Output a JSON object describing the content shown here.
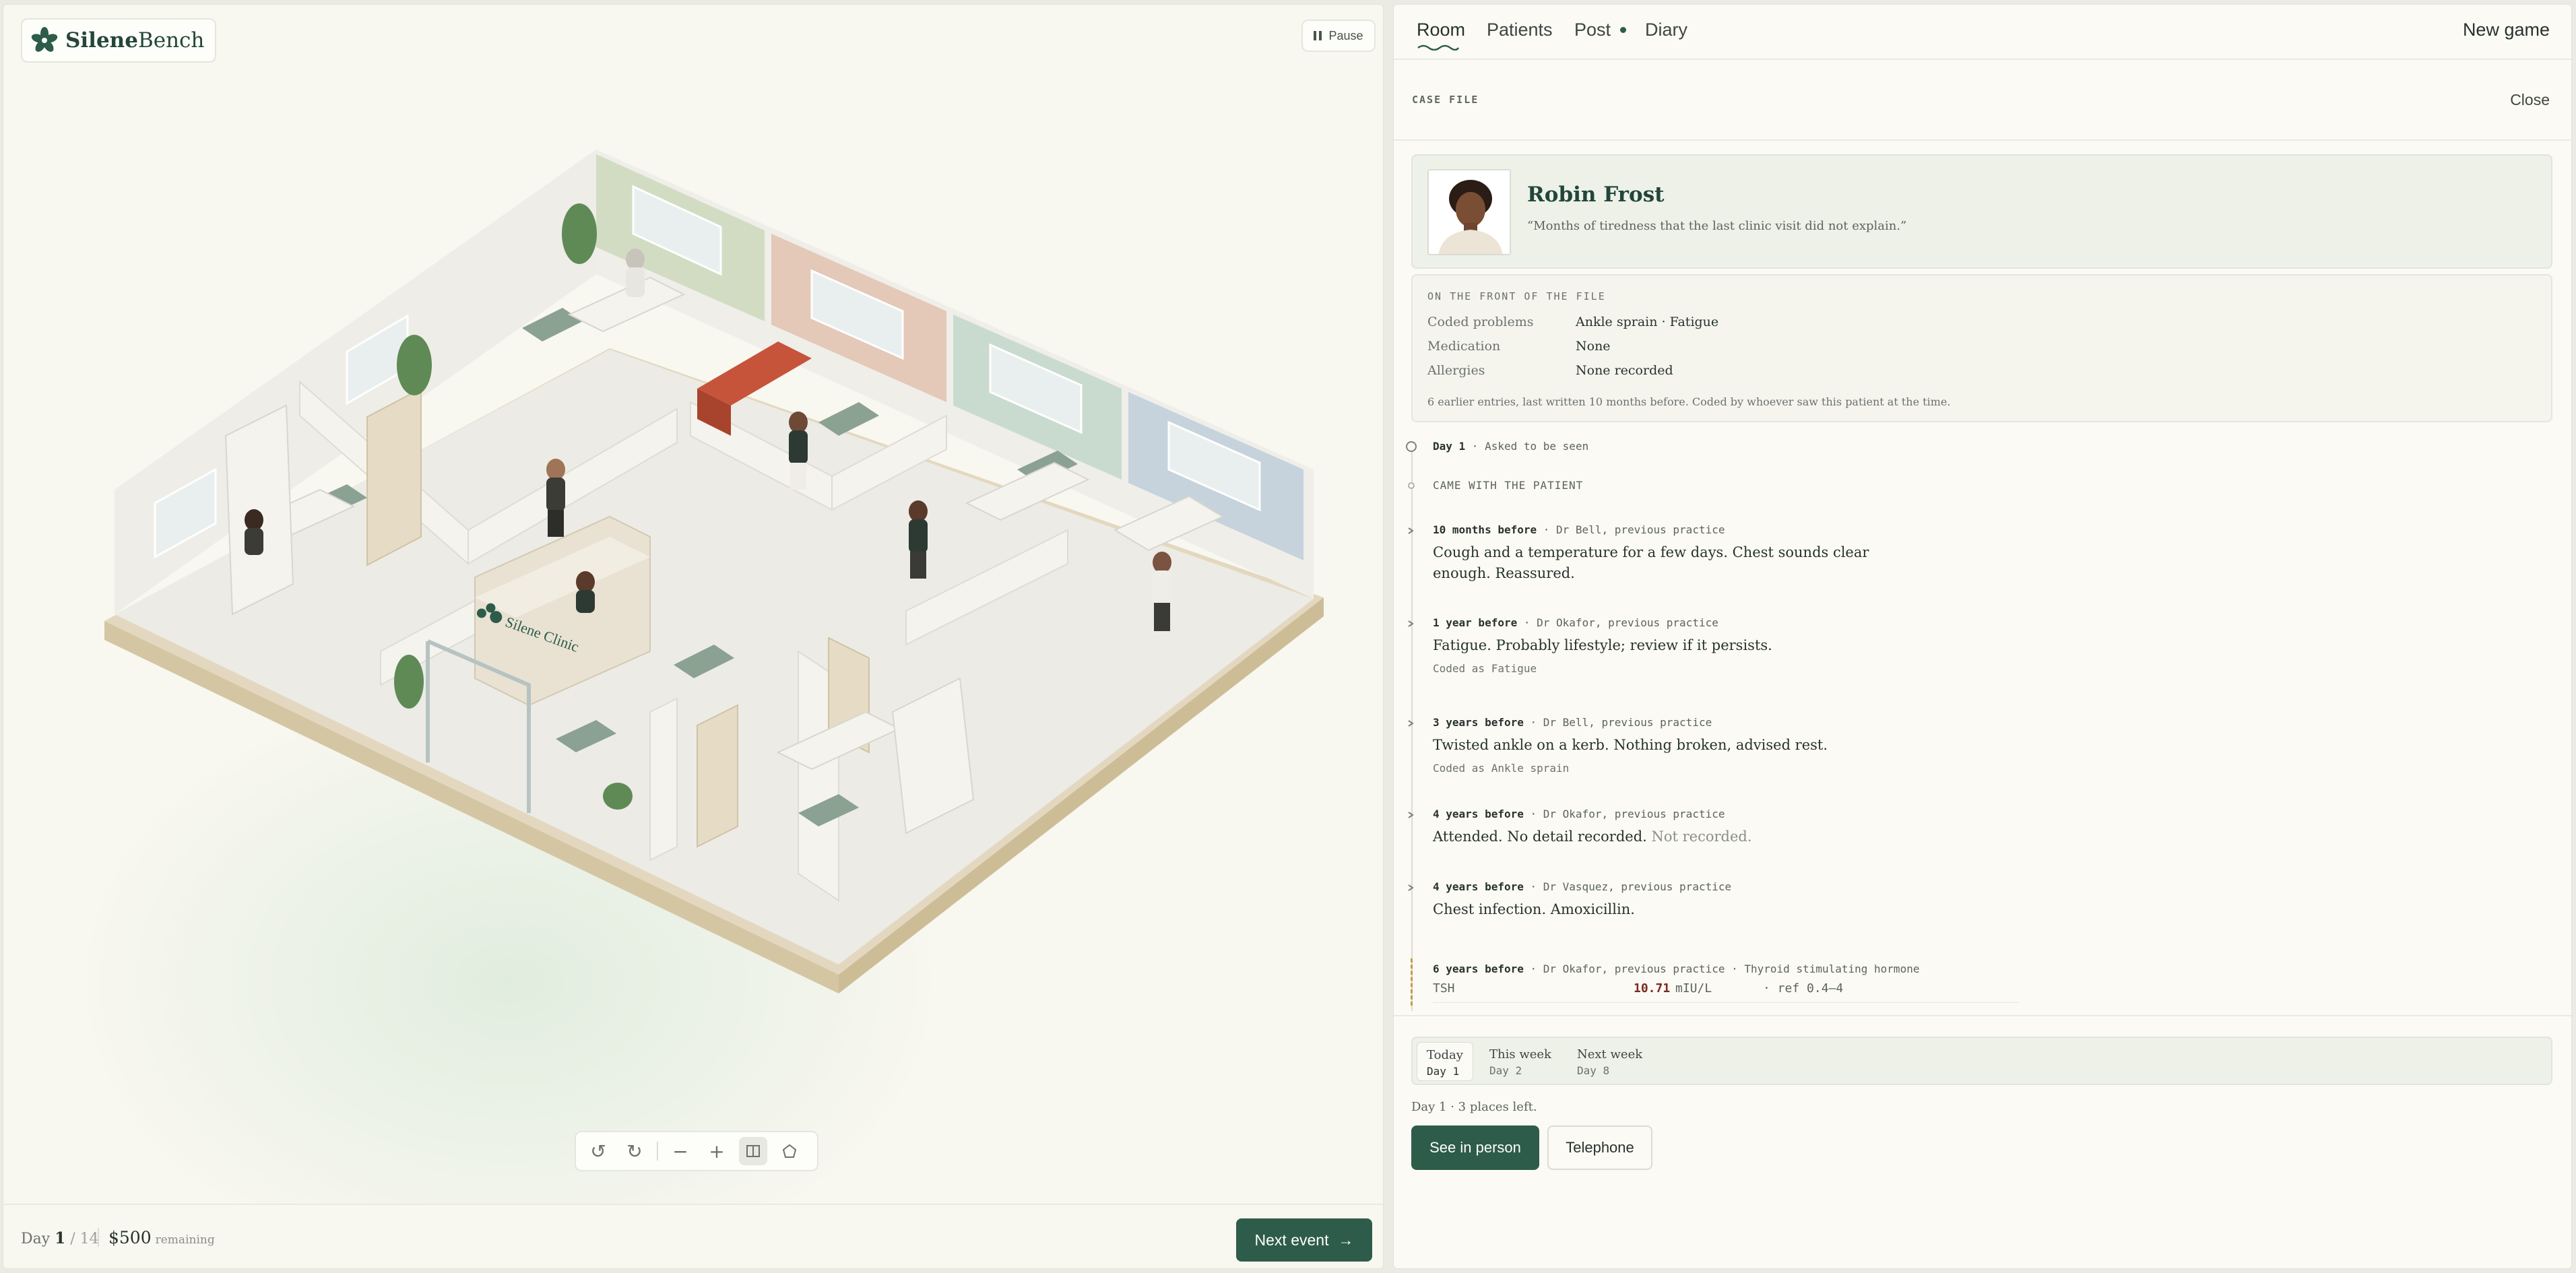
{
  "app": {
    "brand_bold": "Silene",
    "brand_rest": "Bench",
    "pause_label": "Pause",
    "clinic_sign": "Silene Clinic"
  },
  "footer": {
    "day_prefix": "Day",
    "day_current": "1",
    "day_total": "/ 14",
    "budget": "$500",
    "budget_suffix": "remaining",
    "next_event_label": "Next event",
    "next_event_icon": "arrow-right-icon"
  },
  "toolbar": {
    "icons": [
      "rotate-left-icon",
      "rotate-right-icon",
      "zoom-out-icon",
      "zoom-in-icon",
      "walls-toggle-icon",
      "home-view-icon"
    ]
  },
  "nav": {
    "tabs": [
      {
        "label": "Room",
        "active": true
      },
      {
        "label": "Patients",
        "active": false
      },
      {
        "label": "Post",
        "active": false,
        "has_dot": true
      },
      {
        "label": "Diary",
        "active": false
      }
    ],
    "new_game_label": "New game"
  },
  "case_file": {
    "header": "CASE FILE",
    "close_label": "Close",
    "patient": {
      "name": "Robin Frost",
      "quote": "“Months of tiredness that the last clinic visit did not explain.”"
    },
    "front": {
      "title": "ON THE FRONT OF THE FILE",
      "rows": [
        {
          "key": "Coded problems",
          "value": "Ankle sprain · Fatigue"
        },
        {
          "key": "Medication",
          "value": "None"
        },
        {
          "key": "Allergies",
          "value": "None recorded"
        }
      ],
      "note": "6 earlier entries, last written 10 months before. Coded by whoever saw this patient at the time."
    }
  },
  "timeline": {
    "day_marker": {
      "when": "Day 1",
      "sep": " · ",
      "what": "Asked to be seen"
    },
    "came_with": "CAME WITH THE PATIENT",
    "entries": [
      {
        "when": "10 months before",
        "who": " · Dr Bell, previous practice",
        "text": "Cough and a temperature for a few days. Chest sounds clear enough. Reassured.",
        "coded": ""
      },
      {
        "when": "1 year before",
        "who": " · Dr Okafor, previous practice",
        "text": "Fatigue. Probably lifestyle; review if it persists.",
        "coded": "Coded as Fatigue"
      },
      {
        "when": "3 years before",
        "who": " · Dr Bell, previous practice",
        "text": "Twisted ankle on a kerb. Nothing broken, advised rest.",
        "coded": "Coded as Ankle sprain"
      },
      {
        "when": "4 years before",
        "who": " · Dr Okafor, previous practice",
        "text": "Attended. No detail recorded.",
        "text_muted": " Not recorded.",
        "coded": ""
      },
      {
        "when": "4 years before",
        "who": " · Dr Vasquez, previous practice",
        "text": "Chest infection. Amoxicillin.",
        "coded": ""
      },
      {
        "when": "6 years before",
        "who": " · Dr Okafor, previous practice · Thyroid stimulating hormone",
        "coded": ""
      }
    ],
    "lab": {
      "name": "TSH",
      "value": "10.71",
      "unit": "mIU/L",
      "ref": "· ref 0.4–4"
    }
  },
  "schedule": {
    "options": [
      {
        "label": "Today",
        "day": "Day 1",
        "active": true
      },
      {
        "label": "This week",
        "day": "Day 2",
        "active": false
      },
      {
        "label": "Next week",
        "day": "Day 8",
        "active": false
      }
    ],
    "places_text": "Day 1 · 3 places left.",
    "see_label": "See in person",
    "telephone_label": "Telephone"
  },
  "colors": {
    "brand_green": "#2e5c4a",
    "panel_bg": "#fbfaf5",
    "lab_high": "#7a2a22"
  }
}
